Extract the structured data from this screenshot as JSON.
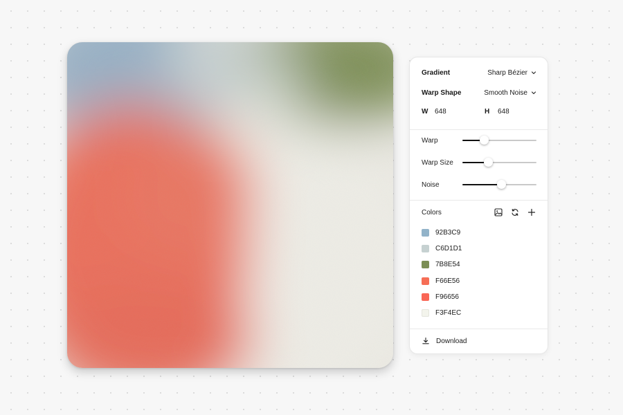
{
  "panel": {
    "gradient": {
      "label": "Gradient",
      "value": "Sharp Bézier"
    },
    "warp_shape": {
      "label": "Warp Shape",
      "value": "Smooth Noise"
    },
    "dimensions": {
      "w_label": "W",
      "w_value": "648",
      "h_label": "H",
      "h_value": "648"
    },
    "sliders": [
      {
        "label": "Warp",
        "value": 0.29
      },
      {
        "label": "Warp Size",
        "value": 0.35
      },
      {
        "label": "Noise",
        "value": 0.53
      }
    ],
    "colors_label": "Colors",
    "colors": [
      {
        "hex": "92B3C9",
        "swatch": "#92B3C9"
      },
      {
        "hex": "C6D1D1",
        "swatch": "#C6D1D1"
      },
      {
        "hex": "7B8E54",
        "swatch": "#7B8E54"
      },
      {
        "hex": "F66E56",
        "swatch": "#F66E56"
      },
      {
        "hex": "F96656",
        "swatch": "#F96656"
      },
      {
        "hex": "F3F4EC",
        "swatch": "#F3F4EC"
      }
    ],
    "download_label": "Download"
  },
  "icons": {
    "image": "image-icon",
    "refresh": "refresh-icon",
    "add": "plus-icon",
    "download": "download-icon",
    "chevron": "chevron-down-icon"
  }
}
